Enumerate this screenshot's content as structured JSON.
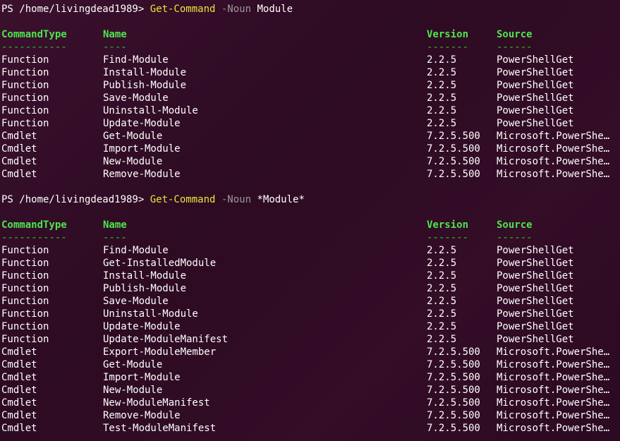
{
  "prompt": "PS /home/livingdead1989> ",
  "columns": {
    "type": "CommandType",
    "name": "Name",
    "version": "Version",
    "source": "Source",
    "type_dash": "-----------",
    "name_dash": "----",
    "version_dash": "-------",
    "source_dash": "------"
  },
  "blocks": [
    {
      "command": "Get-Command",
      "param": "-Noun",
      "arg": "Module",
      "rows": [
        {
          "type": "Function",
          "name": "Find-Module",
          "version": "2.2.5",
          "source": "PowerShellGet"
        },
        {
          "type": "Function",
          "name": "Install-Module",
          "version": "2.2.5",
          "source": "PowerShellGet"
        },
        {
          "type": "Function",
          "name": "Publish-Module",
          "version": "2.2.5",
          "source": "PowerShellGet"
        },
        {
          "type": "Function",
          "name": "Save-Module",
          "version": "2.2.5",
          "source": "PowerShellGet"
        },
        {
          "type": "Function",
          "name": "Uninstall-Module",
          "version": "2.2.5",
          "source": "PowerShellGet"
        },
        {
          "type": "Function",
          "name": "Update-Module",
          "version": "2.2.5",
          "source": "PowerShellGet"
        },
        {
          "type": "Cmdlet",
          "name": "Get-Module",
          "version": "7.2.5.500",
          "source": "Microsoft.PowerShe…"
        },
        {
          "type": "Cmdlet",
          "name": "Import-Module",
          "version": "7.2.5.500",
          "source": "Microsoft.PowerShe…"
        },
        {
          "type": "Cmdlet",
          "name": "New-Module",
          "version": "7.2.5.500",
          "source": "Microsoft.PowerShe…"
        },
        {
          "type": "Cmdlet",
          "name": "Remove-Module",
          "version": "7.2.5.500",
          "source": "Microsoft.PowerShe…"
        }
      ]
    },
    {
      "command": "Get-Command",
      "param": "-Noun",
      "arg": "*Module*",
      "rows": [
        {
          "type": "Function",
          "name": "Find-Module",
          "version": "2.2.5",
          "source": "PowerShellGet"
        },
        {
          "type": "Function",
          "name": "Get-InstalledModule",
          "version": "2.2.5",
          "source": "PowerShellGet"
        },
        {
          "type": "Function",
          "name": "Install-Module",
          "version": "2.2.5",
          "source": "PowerShellGet"
        },
        {
          "type": "Function",
          "name": "Publish-Module",
          "version": "2.2.5",
          "source": "PowerShellGet"
        },
        {
          "type": "Function",
          "name": "Save-Module",
          "version": "2.2.5",
          "source": "PowerShellGet"
        },
        {
          "type": "Function",
          "name": "Uninstall-Module",
          "version": "2.2.5",
          "source": "PowerShellGet"
        },
        {
          "type": "Function",
          "name": "Update-Module",
          "version": "2.2.5",
          "source": "PowerShellGet"
        },
        {
          "type": "Function",
          "name": "Update-ModuleManifest",
          "version": "2.2.5",
          "source": "PowerShellGet"
        },
        {
          "type": "Cmdlet",
          "name": "Export-ModuleMember",
          "version": "7.2.5.500",
          "source": "Microsoft.PowerShe…"
        },
        {
          "type": "Cmdlet",
          "name": "Get-Module",
          "version": "7.2.5.500",
          "source": "Microsoft.PowerShe…"
        },
        {
          "type": "Cmdlet",
          "name": "Import-Module",
          "version": "7.2.5.500",
          "source": "Microsoft.PowerShe…"
        },
        {
          "type": "Cmdlet",
          "name": "New-Module",
          "version": "7.2.5.500",
          "source": "Microsoft.PowerShe…"
        },
        {
          "type": "Cmdlet",
          "name": "New-ModuleManifest",
          "version": "7.2.5.500",
          "source": "Microsoft.PowerShe…"
        },
        {
          "type": "Cmdlet",
          "name": "Remove-Module",
          "version": "7.2.5.500",
          "source": "Microsoft.PowerShe…"
        },
        {
          "type": "Cmdlet",
          "name": "Test-ModuleManifest",
          "version": "7.2.5.500",
          "source": "Microsoft.PowerShe…"
        }
      ]
    }
  ]
}
